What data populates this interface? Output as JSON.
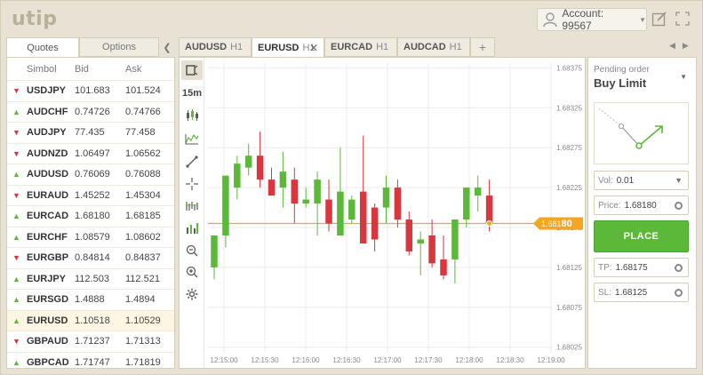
{
  "header": {
    "logo": "utip",
    "account_label": "Account: 99567"
  },
  "left_panel": {
    "tabs": [
      "Quotes",
      "Options"
    ],
    "columns": [
      "Simbol",
      "Bid",
      "Ask"
    ],
    "quotes": [
      {
        "symbol": "USDJPY",
        "bid": "101.683",
        "ask": "101.524",
        "dir": "down"
      },
      {
        "symbol": "AUDCHF",
        "bid": "0.74726",
        "ask": "0.74766",
        "dir": "up"
      },
      {
        "symbol": "AUDJPY",
        "bid": "77.435",
        "ask": "77.458",
        "dir": "down"
      },
      {
        "symbol": "AUDNZD",
        "bid": "1.06497",
        "ask": "1.06562",
        "dir": "down"
      },
      {
        "symbol": "AUDUSD",
        "bid": "0.76069",
        "ask": "0.76088",
        "dir": "up"
      },
      {
        "symbol": "EURAUD",
        "bid": "1.45252",
        "ask": "1.45304",
        "dir": "down"
      },
      {
        "symbol": "EURCAD",
        "bid": "1.68180",
        "ask": "1.68185",
        "dir": "up"
      },
      {
        "symbol": "EURCHF",
        "bid": "1.08579",
        "ask": "1.08602",
        "dir": "up"
      },
      {
        "symbol": "EURGBP",
        "bid": "0.84814",
        "ask": "0.84837",
        "dir": "down"
      },
      {
        "symbol": "EURJPY",
        "bid": "112.503",
        "ask": "112.521",
        "dir": "up"
      },
      {
        "symbol": "EURSGD",
        "bid": "1.4888",
        "ask": "1.4894",
        "dir": "up"
      },
      {
        "symbol": "EURUSD",
        "bid": "1.10518",
        "ask": "1.10529",
        "dir": "up",
        "selected": true
      },
      {
        "symbol": "GBPAUD",
        "bid": "1.71237",
        "ask": "1.71313",
        "dir": "down"
      },
      {
        "symbol": "GBPCAD",
        "bid": "1.71747",
        "ask": "1.71819",
        "dir": "up"
      }
    ]
  },
  "chart_tabs": [
    {
      "pair": "AUDUSD",
      "tf": "H1"
    },
    {
      "pair": "EURUSD",
      "tf": "H1",
      "active": true
    },
    {
      "pair": "EURCAD",
      "tf": "H1"
    },
    {
      "pair": "AUDCAD",
      "tf": "H1"
    }
  ],
  "add_tab_label": "+",
  "toolbar": {
    "timeframe": "15m"
  },
  "colors": {
    "up": "#5cb838",
    "down": "#d9363e",
    "price_line": "#f4a623",
    "grid": "#ebebeb"
  },
  "chart_data": {
    "type": "candlestick",
    "y_ticks": [
      "1.68375",
      "1.68325",
      "1.68275",
      "1.68225",
      "1.68175",
      "1.68125",
      "1.68075",
      "1.68025"
    ],
    "x_ticks": [
      "12:15:00",
      "12:15:30",
      "12:16:00",
      "12:16:30",
      "12:17:00",
      "12:17:30",
      "12:18:00",
      "12:18:30",
      "12:19:00"
    ],
    "ylim": [
      1.68018,
      1.68381
    ],
    "current_price": 1.6818,
    "current_price_label": {
      "main": "1.681",
      "emph": "80"
    },
    "candles": [
      {
        "o": 1.68125,
        "h": 1.6814,
        "l": 1.6811,
        "c": 1.68165
      },
      {
        "o": 1.68165,
        "h": 1.682,
        "l": 1.6815,
        "c": 1.6824
      },
      {
        "o": 1.68225,
        "h": 1.6821,
        "l": 1.68265,
        "c": 1.68255
      },
      {
        "o": 1.6825,
        "h": 1.6824,
        "l": 1.6828,
        "c": 1.68265
      },
      {
        "o": 1.68265,
        "h": 1.68295,
        "l": 1.68225,
        "c": 1.68235
      },
      {
        "o": 1.68235,
        "h": 1.6825,
        "l": 1.68215,
        "c": 1.68215
      },
      {
        "o": 1.68225,
        "h": 1.682,
        "l": 1.6827,
        "c": 1.68245
      },
      {
        "o": 1.68235,
        "h": 1.6825,
        "l": 1.6818,
        "c": 1.68205
      },
      {
        "o": 1.68205,
        "h": 1.68225,
        "l": 1.682,
        "c": 1.6821
      },
      {
        "o": 1.68205,
        "h": 1.68245,
        "l": 1.68165,
        "c": 1.68235
      },
      {
        "o": 1.6821,
        "h": 1.68235,
        "l": 1.6817,
        "c": 1.6818
      },
      {
        "o": 1.68165,
        "h": 1.68275,
        "l": 1.68165,
        "c": 1.6822
      },
      {
        "o": 1.68185,
        "h": 1.6818,
        "l": 1.68215,
        "c": 1.6821
      },
      {
        "o": 1.6822,
        "h": 1.6829,
        "l": 1.68155,
        "c": 1.68155
      },
      {
        "o": 1.682,
        "h": 1.68205,
        "l": 1.68145,
        "c": 1.6816
      },
      {
        "o": 1.682,
        "h": 1.6824,
        "l": 1.6818,
        "c": 1.68225
      },
      {
        "o": 1.68225,
        "h": 1.68235,
        "l": 1.68175,
        "c": 1.68185
      },
      {
        "o": 1.68185,
        "h": 1.68195,
        "l": 1.6814,
        "c": 1.68145
      },
      {
        "o": 1.68155,
        "h": 1.6817,
        "l": 1.68115,
        "c": 1.6816
      },
      {
        "o": 1.68165,
        "h": 1.68185,
        "l": 1.68125,
        "c": 1.6813
      },
      {
        "o": 1.68135,
        "h": 1.68165,
        "l": 1.6811,
        "c": 1.68115
      },
      {
        "o": 1.68135,
        "h": 1.6818,
        "l": 1.68105,
        "c": 1.68185
      },
      {
        "o": 1.68185,
        "h": 1.68205,
        "l": 1.68175,
        "c": 1.68225
      },
      {
        "o": 1.68215,
        "h": 1.6824,
        "l": 1.68195,
        "c": 1.68225
      },
      {
        "o": 1.68215,
        "h": 1.68235,
        "l": 1.6817,
        "c": 1.6818
      }
    ]
  },
  "order_panel": {
    "label": "Pending order",
    "type": "Buy Limit",
    "volume_label": "Vol:",
    "volume": "0.01",
    "price_label": "Price:",
    "price": "1.68180",
    "place_label": "PLACE",
    "tp_label": "TP:",
    "tp": "1.68175",
    "sl_label": "SL:",
    "sl": "1.68125"
  }
}
